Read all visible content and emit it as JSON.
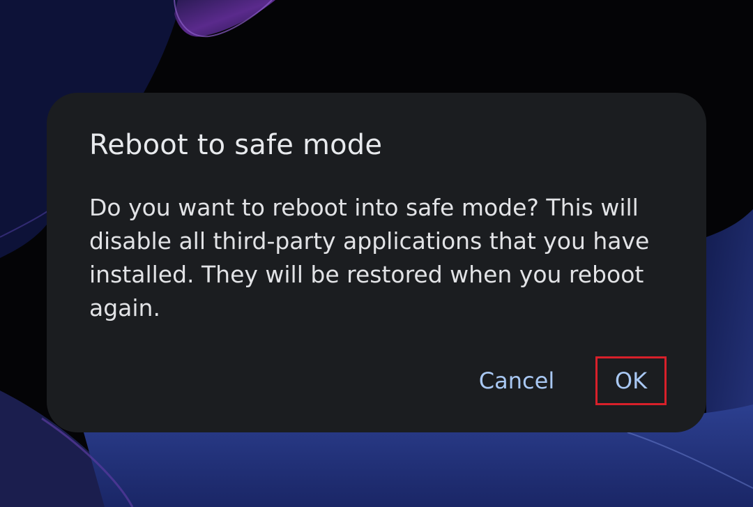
{
  "dialog": {
    "title": "Reboot to safe mode",
    "message": "Do you want to reboot into safe mode? This will disable all third-party applications that you have installed. They will be restored when you reboot again.",
    "cancel_label": "Cancel",
    "ok_label": "OK"
  },
  "colors": {
    "dialog_background": "#1b1d20",
    "button_text": "#a9c8f3",
    "highlight_box": "#d8202a"
  }
}
